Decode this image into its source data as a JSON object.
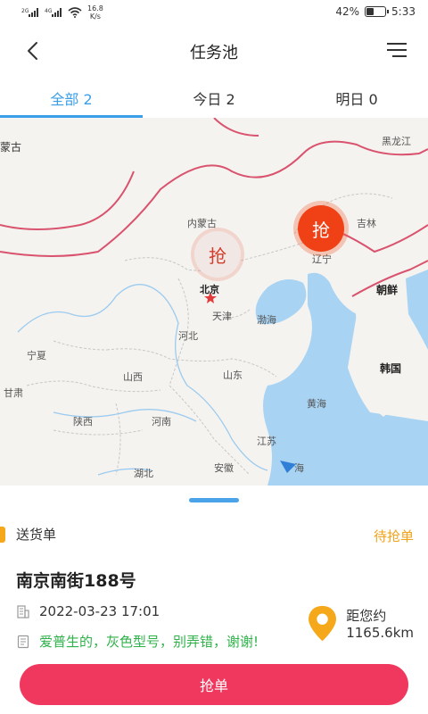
{
  "status_bar": {
    "network_1": "2G",
    "network_2": "4G",
    "speed_value": "16.8",
    "speed_unit": "K/s",
    "battery": "42%",
    "battery_level": 0.42,
    "time": "5:33"
  },
  "nav": {
    "title": "任务池",
    "back_icon": "back-arrow-icon",
    "menu_icon": "menu-icon"
  },
  "tabs": [
    {
      "label": "全部 2",
      "active": true
    },
    {
      "label": "今日 2",
      "active": false
    },
    {
      "label": "明日 0",
      "active": false
    }
  ],
  "map": {
    "labels": {
      "mongolia": "蒙古",
      "heilongjiang": "黑龙江",
      "neimenggu": "内蒙古",
      "jilin": "吉林",
      "liaoning": "辽宁",
      "chaoxian": "朝鲜",
      "beijing": "北京",
      "tianjin": "天津",
      "bohai": "渤海",
      "hebei": "河北",
      "ningxia": "宁夏",
      "shanxi": "山西",
      "shandong": "山东",
      "hanguo": "韩国",
      "gansu": "甘肃",
      "shaanxi": "陕西",
      "henan": "河南",
      "huanghai": "黄海",
      "jiangsu": "江苏",
      "hubei": "湖北",
      "anhui": "安徽",
      "shanghai": "海"
    },
    "markers": [
      {
        "label": "抢",
        "style": "light"
      },
      {
        "label": "抢",
        "style": "strong"
      }
    ]
  },
  "order": {
    "type_label": "送货单",
    "status": "待抢单",
    "address": "南京南街188号",
    "datetime": "2022-03-23 17:01",
    "distance": "距您约1165.6km",
    "note": "爱普生的，灰色型号，别弄错，谢谢!",
    "button_label": "抢单"
  },
  "colors": {
    "accent_blue": "#3a9ee8",
    "status_orange": "#f0a21a",
    "note_green": "#2fb24a",
    "button_pink": "#f0385e",
    "marker_red": "#f04016"
  }
}
